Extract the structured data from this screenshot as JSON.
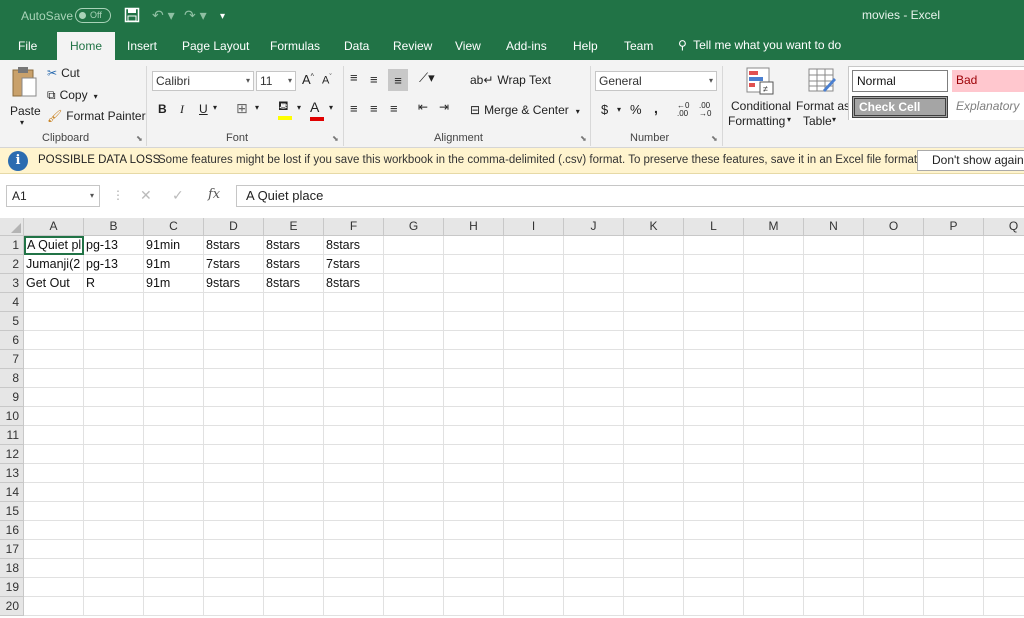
{
  "title_bar": {
    "autosave_label": "AutoSave",
    "autosave_state": "Off",
    "window_title": "movies - Excel"
  },
  "tabs": [
    "File",
    "Home",
    "Insert",
    "Page Layout",
    "Formulas",
    "Data",
    "Review",
    "View",
    "Add-ins",
    "Help",
    "Team"
  ],
  "active_tab": "Home",
  "tell_me": "Tell me what you want to do",
  "ribbon": {
    "clipboard": {
      "paste": "Paste",
      "cut": "Cut",
      "copy": "Copy",
      "format_painter": "Format Painter",
      "label": "Clipboard"
    },
    "font": {
      "font_name": "Calibri",
      "font_size": "11",
      "bold": "B",
      "italic": "I",
      "underline": "U",
      "label": "Font"
    },
    "alignment": {
      "wrap_text": "Wrap Text",
      "merge_center": "Merge & Center",
      "label": "Alignment"
    },
    "number": {
      "format": "General",
      "currency": "$",
      "percent": "%",
      "comma": ",",
      "label": "Number"
    },
    "styles": {
      "conditional_line1": "Conditional",
      "conditional_line2": "Formatting",
      "format_table_line1": "Format as",
      "format_table_line2": "Table",
      "normal": "Normal",
      "bad": "Bad",
      "check_cell": "Check Cell",
      "explanatory": "Explanatory"
    }
  },
  "message_bar": {
    "title": "POSSIBLE DATA LOSS",
    "text": "Some features might be lost if you save this workbook in the comma-delimited (.csv) format. To preserve these features, save it in an Excel file format.",
    "button": "Don't show again"
  },
  "formula_bar": {
    "name_box": "A1",
    "content": "A Quiet place"
  },
  "grid": {
    "columns": [
      "A",
      "B",
      "C",
      "D",
      "E",
      "F",
      "G",
      "H",
      "I",
      "J",
      "K",
      "L",
      "M",
      "N",
      "O",
      "P",
      "Q"
    ],
    "row_numbers": [
      "1",
      "2",
      "3",
      "4",
      "5",
      "6",
      "7",
      "8",
      "9",
      "10",
      "11",
      "12",
      "13",
      "14",
      "15",
      "16",
      "17",
      "18",
      "19",
      "20"
    ],
    "rows": [
      [
        "A Quiet pl",
        "pg-13",
        "91min",
        "8stars",
        "8stars",
        "8stars"
      ],
      [
        "Jumanji(2",
        "pg-13",
        "91m",
        "7stars",
        "8stars",
        "7stars"
      ],
      [
        "Get Out",
        "R",
        "91m",
        "9stars",
        "8stars",
        "8stars"
      ]
    ],
    "selected_cell": "A1"
  },
  "colors": {
    "excel_green": "#217346",
    "message_bar_bg": "#fff4ce",
    "bad_style_bg": "#ffc7ce",
    "bad_style_text": "#9c0006",
    "check_cell_bg": "#a5a5a5"
  }
}
